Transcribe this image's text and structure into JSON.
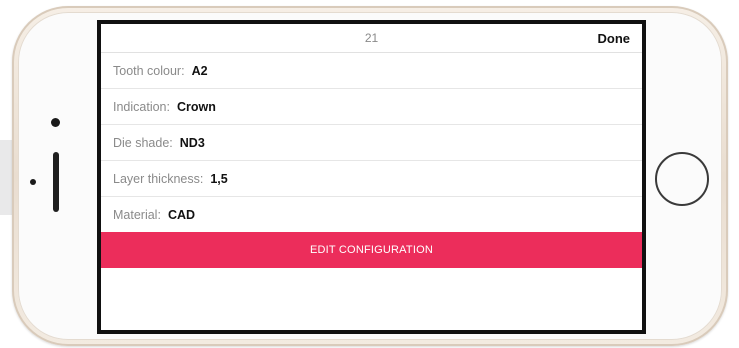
{
  "header": {
    "title": "21",
    "done_label": "Done"
  },
  "config": {
    "rows": [
      {
        "label": "Tooth colour:",
        "value": "A2"
      },
      {
        "label": "Indication:",
        "value": "Crown"
      },
      {
        "label": "Die shade:",
        "value": "ND3"
      },
      {
        "label": "Layer thickness:",
        "value": "1,5"
      },
      {
        "label": "Material:",
        "value": "CAD"
      }
    ]
  },
  "actions": {
    "edit_label": "EDIT CONFIGURATION"
  },
  "colors": {
    "accent": "#ec2d5b",
    "phone_body": "#efe4d8"
  }
}
